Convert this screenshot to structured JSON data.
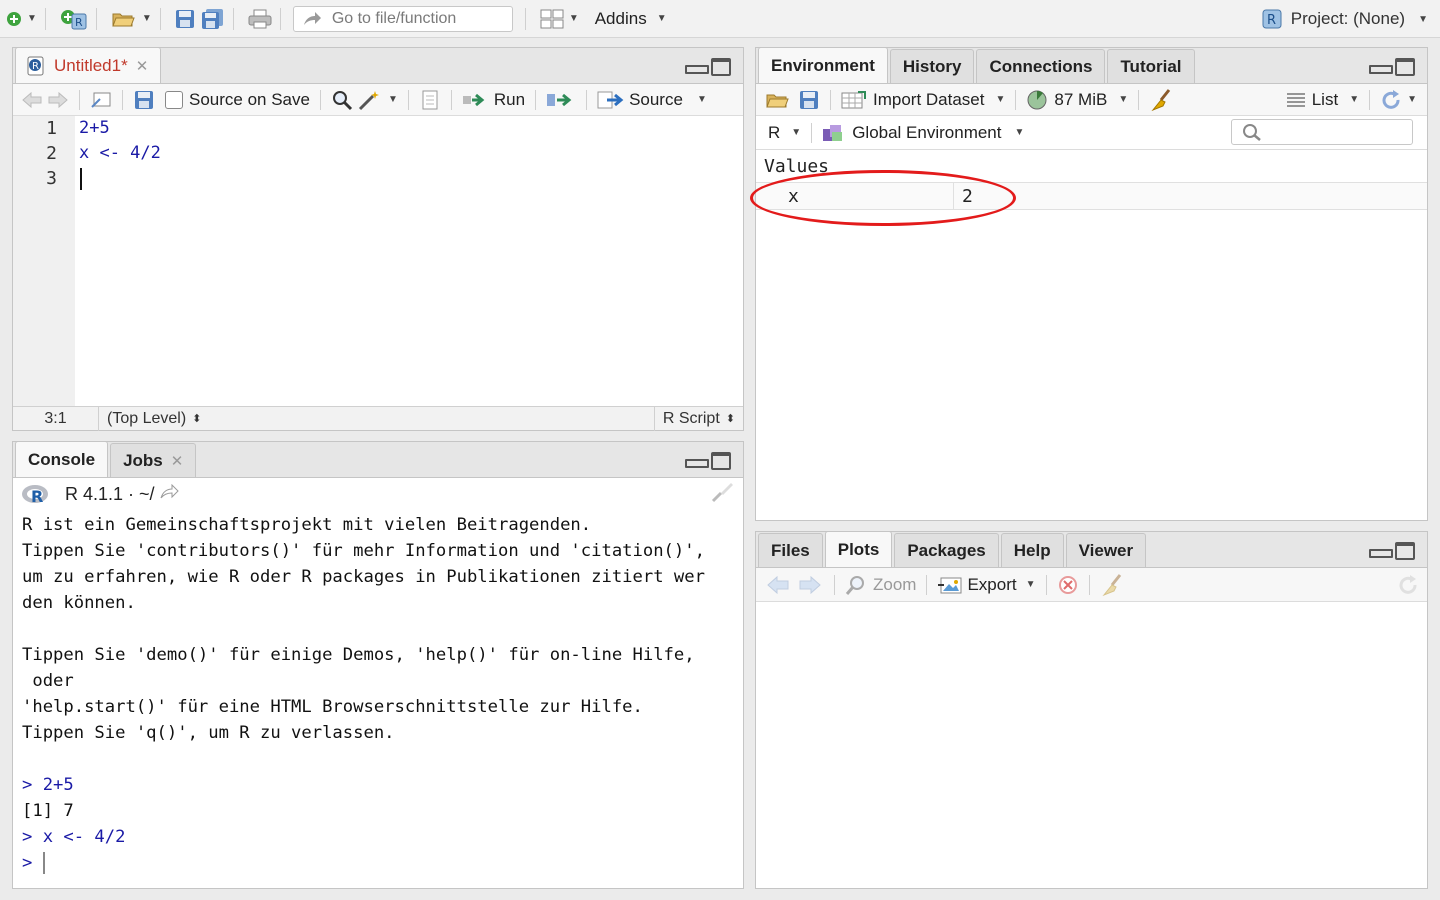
{
  "toolbar": {
    "goto_placeholder": "Go to file/function",
    "addins_label": "Addins",
    "project_label": "Project: (None)"
  },
  "source": {
    "tab_label": "Untitled1*",
    "source_on_save_label": "Source on Save",
    "source_on_save_checked": false,
    "run_label": "Run",
    "source_label": "Source",
    "lines": [
      {
        "num": "1",
        "text": "2+5"
      },
      {
        "num": "2",
        "text": "x <- 4/2"
      },
      {
        "num": "3",
        "text": ""
      }
    ],
    "status": {
      "position": "3:1",
      "scope": "(Top Level)",
      "file_type": "R Script"
    }
  },
  "console": {
    "tabs": [
      "Console",
      "Jobs"
    ],
    "header": "R 4.1.1 · ~/",
    "output_lines": [
      {
        "text": "R ist ein Gemeinschaftsprojekt mit vielen Beitragenden.",
        "kind": "out"
      },
      {
        "text": "Tippen Sie 'contributors()' für mehr Information und 'citation()',",
        "kind": "out"
      },
      {
        "text": "um zu erfahren, wie R oder R packages in Publikationen zitiert wer",
        "kind": "out"
      },
      {
        "text": "den können.",
        "kind": "out"
      },
      {
        "text": "",
        "kind": "out"
      },
      {
        "text": "Tippen Sie 'demo()' für einige Demos, 'help()' für on-line Hilfe,",
        "kind": "out"
      },
      {
        "text": " oder",
        "kind": "out"
      },
      {
        "text": "'help.start()' für eine HTML Browserschnittstelle zur Hilfe.",
        "kind": "out"
      },
      {
        "text": "Tippen Sie 'q()', um R zu verlassen.",
        "kind": "out"
      },
      {
        "text": "",
        "kind": "out"
      },
      {
        "text": "> 2+5",
        "kind": "in"
      },
      {
        "text": "[1] 7",
        "kind": "out"
      },
      {
        "text": "> x <- 4/2",
        "kind": "in"
      },
      {
        "text": "> ",
        "kind": "in"
      }
    ]
  },
  "environment": {
    "tabs": [
      "Environment",
      "History",
      "Connections",
      "Tutorial"
    ],
    "import_label": "Import Dataset",
    "memory_label": "87 MiB",
    "view_label": "List",
    "lang_label": "R",
    "scope_label": "Global Environment",
    "section_label": "Values",
    "values": [
      {
        "name": "x",
        "value": "2"
      }
    ]
  },
  "files": {
    "tabs": [
      "Files",
      "Plots",
      "Packages",
      "Help",
      "Viewer"
    ],
    "zoom_label": "Zoom",
    "export_label": "Export"
  },
  "colors": {
    "code_blue": "#1a1aa6",
    "source_tab_red": "#c0392b",
    "highlight_red": "#e31b1b"
  }
}
